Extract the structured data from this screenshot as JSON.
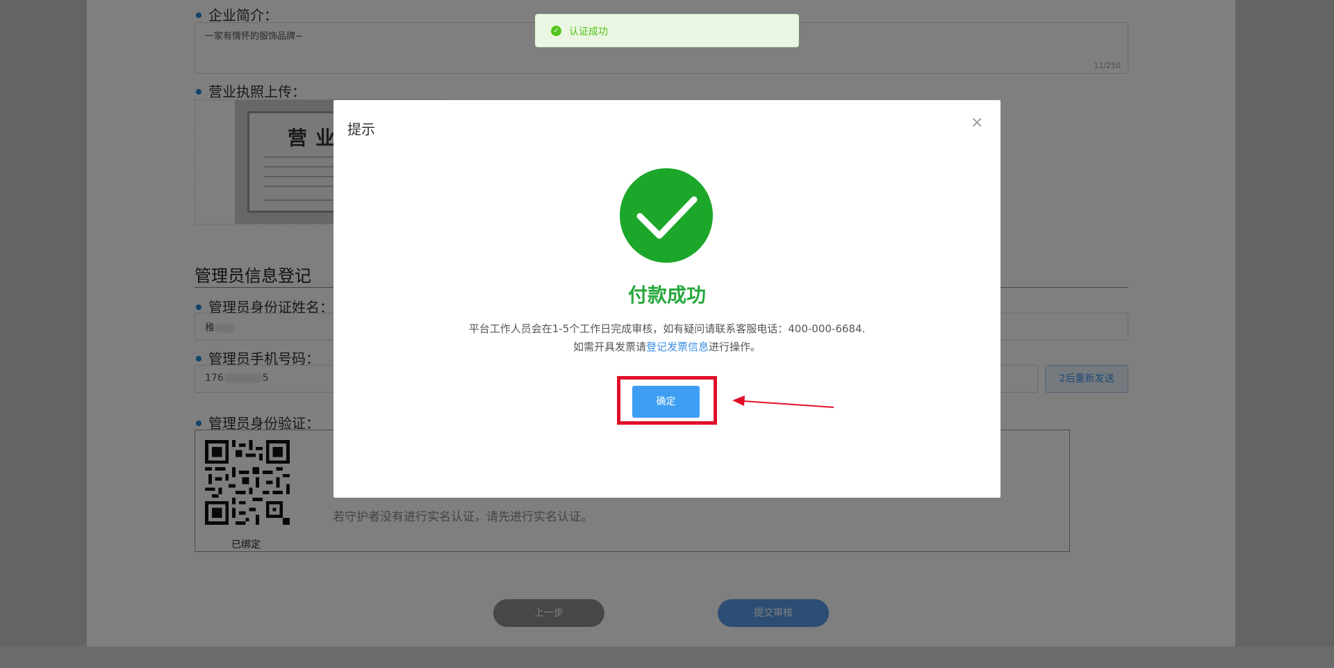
{
  "form": {
    "intro_label": "企业简介：",
    "intro_value": "一家有情怀的服饰品牌~",
    "intro_counter": "11/250",
    "license_label": "营业执照上传：",
    "license_image_text": "营业执",
    "admin_heading": "管理员信息登记",
    "admin_name_label": "管理员身份证姓名：",
    "admin_name_value": "稚",
    "admin_phone_label": "管理员手机号码：",
    "admin_phone_prefix": "176",
    "admin_phone_suffix": "5",
    "resend_label": "2后重新发送",
    "verify_label": "管理员身份验证：",
    "bound_label": "已绑定",
    "verify_tip": "若守护者没有进行实名认证，请先进行实名认证。",
    "prev_label": "上一步",
    "submit_label": "提交审核"
  },
  "toast": {
    "text": "认证成功",
    "icon": "check-circle-icon"
  },
  "modal": {
    "title": "提示",
    "close_icon": "close-icon",
    "success_icon": "check-circle-icon",
    "success_title": "付款成功",
    "message": "平台工作人员会在1-5个工作日完成审核，如有疑问请联系客服电话：400-000-6684.",
    "invoice_prefix": "如需开具发票请",
    "invoice_link": "登记发票信息",
    "invoice_suffix": "进行操作。",
    "ok_label": "确定"
  },
  "colors": {
    "success_green": "#27a83e",
    "primary_blue": "#3e9ef4",
    "highlight_red": "#e0102a"
  }
}
